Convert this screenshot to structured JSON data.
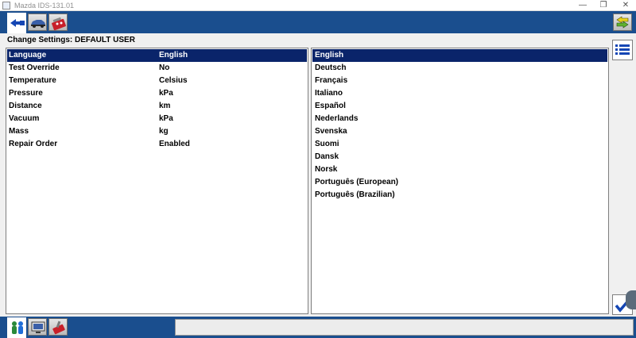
{
  "window": {
    "title": "Mazda IDS-131.01"
  },
  "toolbar": {
    "tabs": [
      "connector-icon",
      "vehicle-icon",
      "toolbox-icon"
    ],
    "right_icon": "exit-arrows-icon"
  },
  "heading": "Change Settings:  DEFAULT USER",
  "settings": [
    {
      "name": "Language",
      "value": "English"
    },
    {
      "name": "Test Override",
      "value": "No"
    },
    {
      "name": "Temperature",
      "value": "Celsius"
    },
    {
      "name": "Pressure",
      "value": "kPa"
    },
    {
      "name": "Distance",
      "value": "km"
    },
    {
      "name": "Vacuum",
      "value": "kPa"
    },
    {
      "name": "Mass",
      "value": "kg"
    },
    {
      "name": "Repair Order",
      "value": "Enabled"
    }
  ],
  "selected_setting": "Language",
  "languages": [
    "English",
    "Deutsch",
    "Français",
    "Italiano",
    "Español",
    "Nederlands",
    "Svenska",
    "Suomi",
    "Dansk",
    "Norsk",
    "Português (European)",
    "Português (Brazilian)"
  ],
  "selected_language": "English",
  "side_buttons": [
    "list-icon",
    "checkmark-icon"
  ],
  "bottom_tabs": [
    "users-icon",
    "monitor-icon",
    "tools-icon"
  ],
  "status_text": "",
  "colors": {
    "band": "#1a4e8e",
    "selection": "#0a246a",
    "background": "#f0f0f0"
  }
}
